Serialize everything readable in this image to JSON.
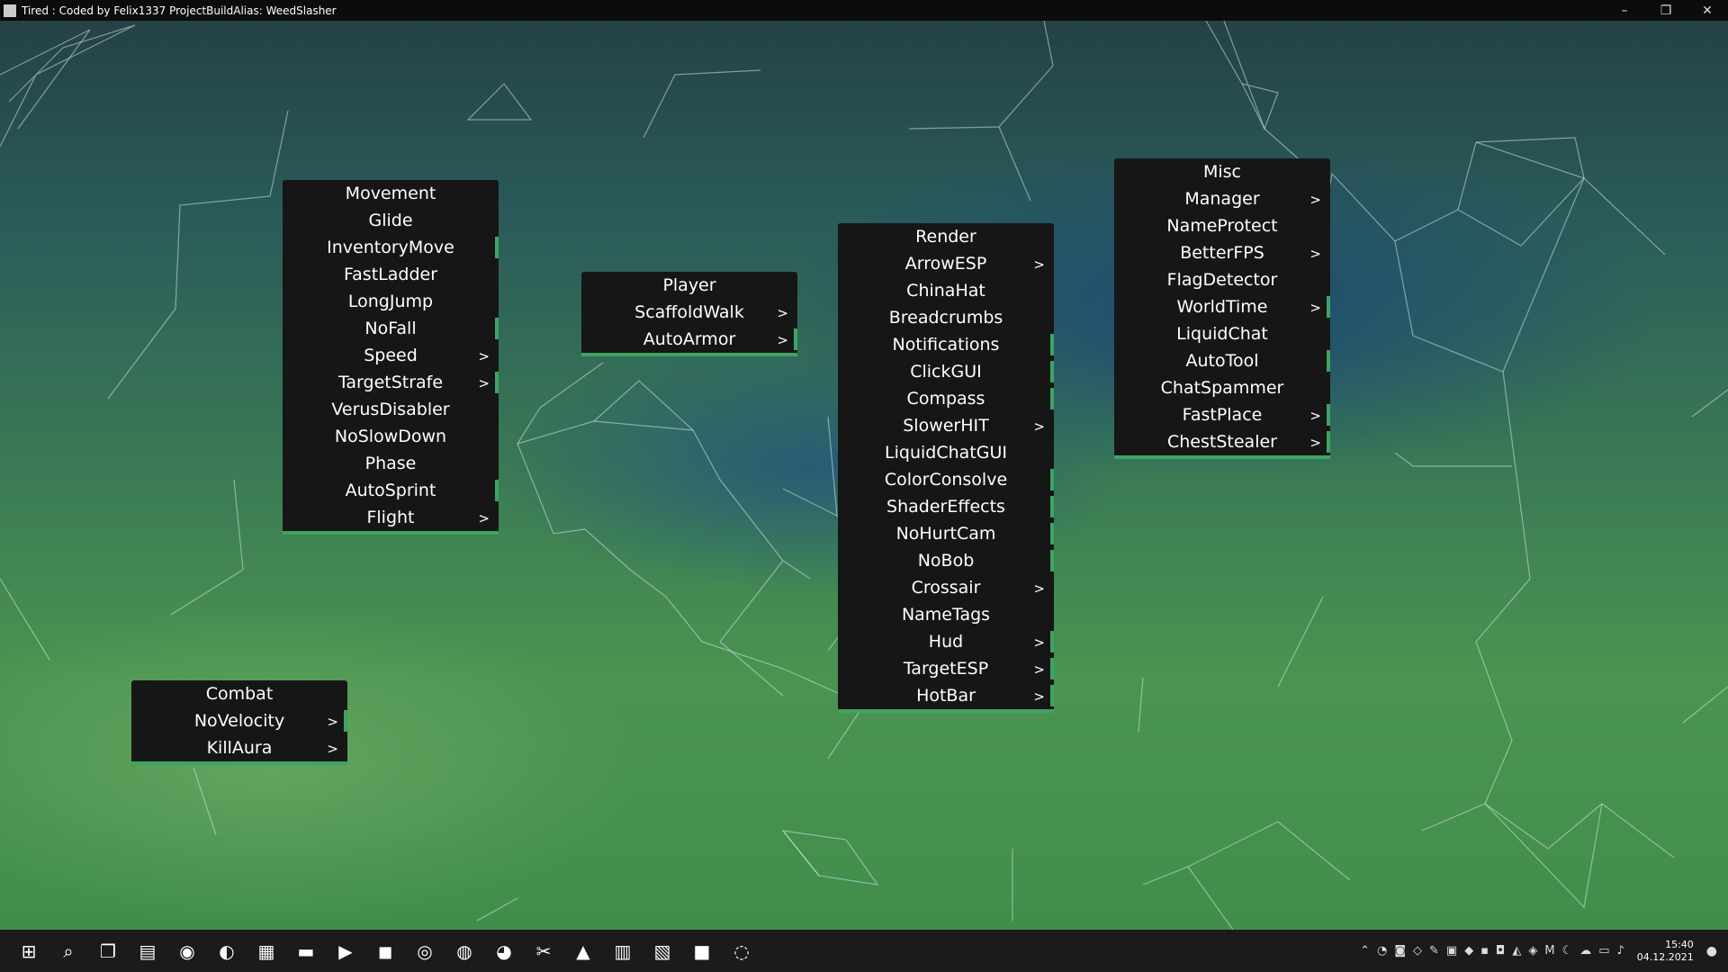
{
  "window": {
    "title": "Tired : Coded by Felix1337 ProjectBuildAlias: WeedSlasher"
  },
  "panels": {
    "movement": {
      "title": "Movement",
      "items": [
        {
          "label": "Glide",
          "arrow": "",
          "enabled": false
        },
        {
          "label": "InventoryMove",
          "arrow": "",
          "enabled": true
        },
        {
          "label": "FastLadder",
          "arrow": "",
          "enabled": false
        },
        {
          "label": "LongJump",
          "arrow": "",
          "enabled": false
        },
        {
          "label": "NoFall",
          "arrow": "",
          "enabled": true
        },
        {
          "label": "Speed",
          "arrow": ">",
          "enabled": false
        },
        {
          "label": "TargetStrafe",
          "arrow": ">",
          "enabled": true
        },
        {
          "label": "VerusDisabler",
          "arrow": "",
          "enabled": false
        },
        {
          "label": "NoSlowDown",
          "arrow": "",
          "enabled": false
        },
        {
          "label": "Phase",
          "arrow": "",
          "enabled": false
        },
        {
          "label": "AutoSprint",
          "arrow": "",
          "enabled": true
        },
        {
          "label": "Flight",
          "arrow": ">",
          "enabled": false
        }
      ]
    },
    "player": {
      "title": "Player",
      "items": [
        {
          "label": "ScaffoldWalk",
          "arrow": ">",
          "enabled": false
        },
        {
          "label": "AutoArmor",
          "arrow": ">",
          "enabled": true
        }
      ]
    },
    "render": {
      "title": "Render",
      "items": [
        {
          "label": "ArrowESP",
          "arrow": ">",
          "enabled": false
        },
        {
          "label": "ChinaHat",
          "arrow": "",
          "enabled": false
        },
        {
          "label": "Breadcrumbs",
          "arrow": "",
          "enabled": false
        },
        {
          "label": "Notifications",
          "arrow": "",
          "enabled": true
        },
        {
          "label": "ClickGUI",
          "arrow": "",
          "enabled": true
        },
        {
          "label": "Compass",
          "arrow": "",
          "enabled": true
        },
        {
          "label": "SlowerHIT",
          "arrow": ">",
          "enabled": false
        },
        {
          "label": "LiquidChatGUI",
          "arrow": "",
          "enabled": false
        },
        {
          "label": "ColorConsolve",
          "arrow": "",
          "enabled": true
        },
        {
          "label": "ShaderEffects",
          "arrow": "",
          "enabled": true
        },
        {
          "label": "NoHurtCam",
          "arrow": "",
          "enabled": true
        },
        {
          "label": "NoBob",
          "arrow": "",
          "enabled": true
        },
        {
          "label": "Crossair",
          "arrow": ">",
          "enabled": false
        },
        {
          "label": "NameTags",
          "arrow": "",
          "enabled": false
        },
        {
          "label": "Hud",
          "arrow": ">",
          "enabled": true
        },
        {
          "label": "TargetESP",
          "arrow": ">",
          "enabled": true
        },
        {
          "label": "HotBar",
          "arrow": ">",
          "enabled": true
        }
      ]
    },
    "misc": {
      "title": "Misc",
      "items": [
        {
          "label": "Manager",
          "arrow": ">",
          "enabled": false
        },
        {
          "label": "NameProtect",
          "arrow": "",
          "enabled": false
        },
        {
          "label": "BetterFPS",
          "arrow": ">",
          "enabled": false
        },
        {
          "label": "FlagDetector",
          "arrow": "",
          "enabled": false
        },
        {
          "label": "WorldTime",
          "arrow": ">",
          "enabled": true
        },
        {
          "label": "LiquidChat",
          "arrow": "",
          "enabled": false
        },
        {
          "label": "AutoTool",
          "arrow": "",
          "enabled": true
        },
        {
          "label": "ChatSpammer",
          "arrow": "",
          "enabled": false
        },
        {
          "label": "FastPlace",
          "arrow": ">",
          "enabled": true
        },
        {
          "label": "ChestStealer",
          "arrow": ">",
          "enabled": true
        }
      ]
    },
    "combat": {
      "title": "Combat",
      "items": [
        {
          "label": "NoVelocity",
          "arrow": ">",
          "enabled": true
        },
        {
          "label": "KillAura",
          "arrow": ">",
          "enabled": false
        }
      ]
    }
  },
  "taskbar": {
    "apps": [
      {
        "name": "start-icon",
        "glyph": "⊞"
      },
      {
        "name": "search-icon",
        "glyph": "⌕"
      },
      {
        "name": "task-view-icon",
        "glyph": "❐"
      },
      {
        "name": "widgets-icon",
        "glyph": "▤"
      },
      {
        "name": "chat-icon",
        "glyph": "◉"
      },
      {
        "name": "edge-icon",
        "glyph": "◐"
      },
      {
        "name": "store-icon",
        "glyph": "▦"
      },
      {
        "name": "file-explorer-icon",
        "glyph": "▬"
      },
      {
        "name": "youtube-icon",
        "glyph": "▶"
      },
      {
        "name": "intellij-icon",
        "glyph": "◼"
      },
      {
        "name": "chrome-icon",
        "glyph": "◎"
      },
      {
        "name": "steam-icon",
        "glyph": "◍"
      },
      {
        "name": "discord-icon",
        "glyph": "◕"
      },
      {
        "name": "snipping-tool-icon",
        "glyph": "✂"
      },
      {
        "name": "photos-icon",
        "glyph": "▲"
      },
      {
        "name": "winrar-icon",
        "glyph": "▥"
      },
      {
        "name": "notepad-icon",
        "glyph": "▧"
      },
      {
        "name": "minecraft-icon",
        "glyph": "■"
      },
      {
        "name": "obs-icon",
        "glyph": "◌"
      }
    ],
    "tray": [
      "⌃",
      "◔",
      "◙",
      "◇",
      "✎",
      "▣",
      "◆",
      "▪",
      "◘",
      "◭",
      "◈",
      "M",
      "☾",
      "☁",
      "▭",
      "♪"
    ],
    "clock": {
      "time": "15:40",
      "date": "04.12.2021"
    }
  },
  "colors": {
    "accent": "#3ea463",
    "panel_bg": "#161616"
  }
}
